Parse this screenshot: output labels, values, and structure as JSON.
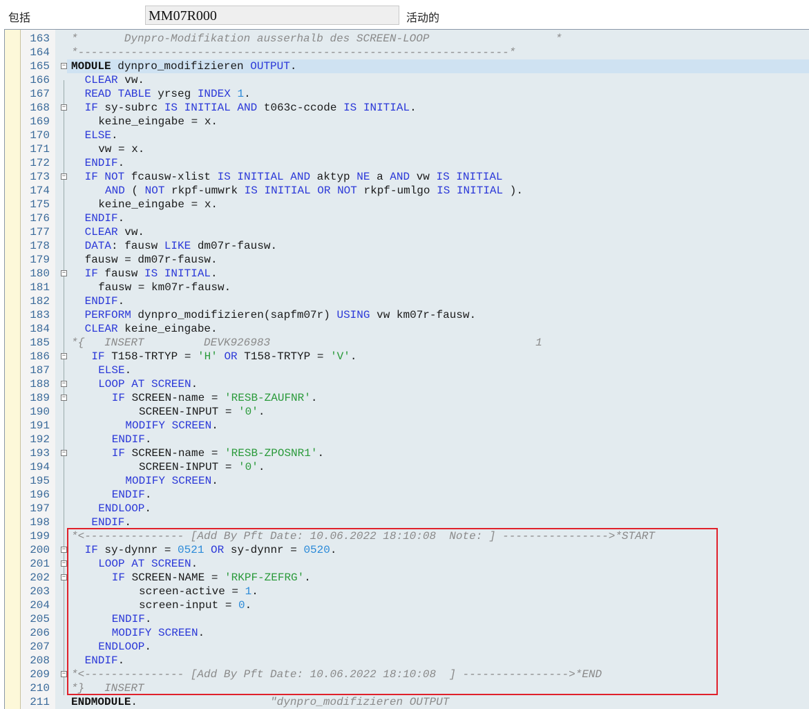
{
  "header": {
    "package_label": "包括",
    "program_name": "MM07R000",
    "status_text": "活动的"
  },
  "highlight": {
    "color": "#e0202a"
  },
  "lines": [
    {
      "n": "163",
      "indent": 0,
      "fold": false,
      "tokens": [
        [
          "cmt",
          "*       Dynpro-Modifikation ausserhalb des SCREEN-LOOP                   *"
        ]
      ]
    },
    {
      "n": "164",
      "indent": 0,
      "fold": false,
      "tokens": [
        [
          "cmt",
          "*-----------------------------------------------------------------*"
        ]
      ]
    },
    {
      "n": "165",
      "indent": 0,
      "fold": true,
      "tokens": [
        [
          "kwb",
          "MODULE"
        ],
        [
          "t",
          " dynpro_modifizieren "
        ],
        [
          "kw",
          "OUTPUT"
        ],
        [
          "t",
          "."
        ]
      ]
    },
    {
      "n": "166",
      "indent": 2,
      "fold": false,
      "tokens": [
        [
          "kw",
          "CLEAR"
        ],
        [
          "t",
          " vw."
        ]
      ]
    },
    {
      "n": "167",
      "indent": 2,
      "fold": false,
      "tokens": [
        [
          "kw",
          "READ TABLE"
        ],
        [
          "t",
          " yrseg "
        ],
        [
          "kw",
          "INDEX"
        ],
        [
          "t",
          " "
        ],
        [
          "num",
          "1"
        ],
        [
          "t",
          "."
        ]
      ]
    },
    {
      "n": "168",
      "indent": 2,
      "fold": true,
      "tokens": [
        [
          "kw",
          "IF"
        ],
        [
          "t",
          " sy-subrc "
        ],
        [
          "kw",
          "IS INITIAL AND"
        ],
        [
          "t",
          " t063c-ccode "
        ],
        [
          "kw",
          "IS INITIAL"
        ],
        [
          "t",
          "."
        ]
      ]
    },
    {
      "n": "169",
      "indent": 4,
      "fold": false,
      "tokens": [
        [
          "t",
          "keine_eingabe = x."
        ]
      ]
    },
    {
      "n": "170",
      "indent": 2,
      "fold": false,
      "tokens": [
        [
          "kw",
          "ELSE"
        ],
        [
          "t",
          "."
        ]
      ]
    },
    {
      "n": "171",
      "indent": 4,
      "fold": false,
      "tokens": [
        [
          "t",
          "vw = x."
        ]
      ]
    },
    {
      "n": "172",
      "indent": 2,
      "fold": false,
      "tokens": [
        [
          "kw",
          "ENDIF"
        ],
        [
          "t",
          "."
        ]
      ]
    },
    {
      "n": "173",
      "indent": 2,
      "fold": true,
      "tokens": [
        [
          "kw",
          "IF NOT"
        ],
        [
          "t",
          " fcausw-xlist "
        ],
        [
          "kw",
          "IS INITIAL AND"
        ],
        [
          "t",
          " aktyp "
        ],
        [
          "kw",
          "NE"
        ],
        [
          "t",
          " a "
        ],
        [
          "kw",
          "AND"
        ],
        [
          "t",
          " vw "
        ],
        [
          "kw",
          "IS INITIAL"
        ]
      ]
    },
    {
      "n": "174",
      "indent": 5,
      "fold": false,
      "tokens": [
        [
          "kw",
          "AND"
        ],
        [
          "t",
          " ( "
        ],
        [
          "kw",
          "NOT"
        ],
        [
          "t",
          " rkpf-umwrk "
        ],
        [
          "kw",
          "IS INITIAL OR NOT"
        ],
        [
          "t",
          " rkpf-umlgo "
        ],
        [
          "kw",
          "IS INITIAL"
        ],
        [
          "t",
          " )."
        ]
      ]
    },
    {
      "n": "175",
      "indent": 4,
      "fold": false,
      "tokens": [
        [
          "t",
          "keine_eingabe = x."
        ]
      ]
    },
    {
      "n": "176",
      "indent": 2,
      "fold": false,
      "tokens": [
        [
          "kw",
          "ENDIF"
        ],
        [
          "t",
          "."
        ]
      ]
    },
    {
      "n": "177",
      "indent": 2,
      "fold": false,
      "tokens": [
        [
          "kw",
          "CLEAR"
        ],
        [
          "t",
          " vw."
        ]
      ]
    },
    {
      "n": "178",
      "indent": 2,
      "fold": false,
      "tokens": [
        [
          "kw",
          "DATA"
        ],
        [
          "t",
          ": fausw "
        ],
        [
          "kw",
          "LIKE"
        ],
        [
          "t",
          " dm07r-fausw."
        ]
      ]
    },
    {
      "n": "179",
      "indent": 2,
      "fold": false,
      "tokens": [
        [
          "t",
          "fausw = dm07r-fausw."
        ]
      ]
    },
    {
      "n": "180",
      "indent": 2,
      "fold": true,
      "tokens": [
        [
          "kw",
          "IF"
        ],
        [
          "t",
          " fausw "
        ],
        [
          "kw",
          "IS INITIAL"
        ],
        [
          "t",
          "."
        ]
      ]
    },
    {
      "n": "181",
      "indent": 4,
      "fold": false,
      "tokens": [
        [
          "t",
          "fausw = km07r-fausw."
        ]
      ]
    },
    {
      "n": "182",
      "indent": 2,
      "fold": false,
      "tokens": [
        [
          "kw",
          "ENDIF"
        ],
        [
          "t",
          "."
        ]
      ]
    },
    {
      "n": "183",
      "indent": 2,
      "fold": false,
      "tokens": [
        [
          "kw",
          "PERFORM"
        ],
        [
          "t",
          " dynpro_modifizieren(sapfm07r) "
        ],
        [
          "kw",
          "USING"
        ],
        [
          "t",
          " vw km07r-fausw."
        ]
      ]
    },
    {
      "n": "184",
      "indent": 2,
      "fold": false,
      "tokens": [
        [
          "kw",
          "CLEAR"
        ],
        [
          "t",
          " keine_eingabe."
        ]
      ]
    },
    {
      "n": "185",
      "indent": 0,
      "fold": false,
      "tokens": [
        [
          "cmt",
          "*{   INSERT         DEVK926983                                        1"
        ]
      ]
    },
    {
      "n": "186",
      "indent": 3,
      "fold": true,
      "tokens": [
        [
          "kw",
          "IF"
        ],
        [
          "t",
          " T158-TRTYP = "
        ],
        [
          "str",
          "'H'"
        ],
        [
          "t",
          " "
        ],
        [
          "kw",
          "OR"
        ],
        [
          "t",
          " T158-TRTYP = "
        ],
        [
          "str",
          "'V'"
        ],
        [
          "t",
          "."
        ]
      ]
    },
    {
      "n": "187",
      "indent": 4,
      "fold": false,
      "tokens": [
        [
          "kw",
          "ELSE"
        ],
        [
          "t",
          "."
        ]
      ]
    },
    {
      "n": "188",
      "indent": 4,
      "fold": true,
      "tokens": [
        [
          "kw",
          "LOOP AT SCREEN"
        ],
        [
          "t",
          "."
        ]
      ]
    },
    {
      "n": "189",
      "indent": 6,
      "fold": true,
      "tokens": [
        [
          "kw",
          "IF"
        ],
        [
          "t",
          " SCREEN-name = "
        ],
        [
          "str",
          "'RESB-ZAUFNR'"
        ],
        [
          "t",
          "."
        ]
      ]
    },
    {
      "n": "190",
      "indent": 10,
      "fold": false,
      "tokens": [
        [
          "t",
          "SCREEN-INPUT = "
        ],
        [
          "str",
          "'0'"
        ],
        [
          "t",
          "."
        ]
      ]
    },
    {
      "n": "191",
      "indent": 8,
      "fold": false,
      "tokens": [
        [
          "kw",
          "MODIFY SCREEN"
        ],
        [
          "t",
          "."
        ]
      ]
    },
    {
      "n": "192",
      "indent": 6,
      "fold": false,
      "tokens": [
        [
          "kw",
          "ENDIF"
        ],
        [
          "t",
          "."
        ]
      ]
    },
    {
      "n": "193",
      "indent": 6,
      "fold": true,
      "tokens": [
        [
          "kw",
          "IF"
        ],
        [
          "t",
          " SCREEN-name = "
        ],
        [
          "str",
          "'RESB-ZPOSNR1'"
        ],
        [
          "t",
          "."
        ]
      ]
    },
    {
      "n": "194",
      "indent": 10,
      "fold": false,
      "tokens": [
        [
          "t",
          "SCREEN-INPUT = "
        ],
        [
          "str",
          "'0'"
        ],
        [
          "t",
          "."
        ]
      ]
    },
    {
      "n": "195",
      "indent": 8,
      "fold": false,
      "tokens": [
        [
          "kw",
          "MODIFY SCREEN"
        ],
        [
          "t",
          "."
        ]
      ]
    },
    {
      "n": "196",
      "indent": 6,
      "fold": false,
      "tokens": [
        [
          "kw",
          "ENDIF"
        ],
        [
          "t",
          "."
        ]
      ]
    },
    {
      "n": "197",
      "indent": 4,
      "fold": false,
      "tokens": [
        [
          "kw",
          "ENDLOOP"
        ],
        [
          "t",
          "."
        ]
      ]
    },
    {
      "n": "198",
      "indent": 3,
      "fold": false,
      "tokens": [
        [
          "kw",
          "ENDIF"
        ],
        [
          "t",
          "."
        ]
      ]
    },
    {
      "n": "199",
      "indent": 0,
      "fold": false,
      "tokens": [
        [
          "cmt",
          "*<--------------- [Add By Pft Date: 10.06.2022 18:10:08  Note: ] ---------------->*START"
        ]
      ]
    },
    {
      "n": "200",
      "indent": 2,
      "fold": true,
      "tokens": [
        [
          "kw",
          "IF"
        ],
        [
          "t",
          " sy-dynnr = "
        ],
        [
          "num",
          "0521"
        ],
        [
          "t",
          " "
        ],
        [
          "kw",
          "OR"
        ],
        [
          "t",
          " sy-dynnr = "
        ],
        [
          "num",
          "0520"
        ],
        [
          "t",
          "."
        ]
      ]
    },
    {
      "n": "201",
      "indent": 4,
      "fold": true,
      "tokens": [
        [
          "kw",
          "LOOP AT SCREEN"
        ],
        [
          "t",
          "."
        ]
      ]
    },
    {
      "n": "202",
      "indent": 6,
      "fold": true,
      "tokens": [
        [
          "kw",
          "IF"
        ],
        [
          "t",
          " SCREEN-NAME = "
        ],
        [
          "str",
          "'RKPF-ZEFRG'"
        ],
        [
          "t",
          "."
        ]
      ]
    },
    {
      "n": "203",
      "indent": 10,
      "fold": false,
      "tokens": [
        [
          "t",
          "screen-active = "
        ],
        [
          "num",
          "1"
        ],
        [
          "t",
          "."
        ]
      ]
    },
    {
      "n": "204",
      "indent": 10,
      "fold": false,
      "tokens": [
        [
          "t",
          "screen-input = "
        ],
        [
          "num",
          "0"
        ],
        [
          "t",
          "."
        ]
      ]
    },
    {
      "n": "205",
      "indent": 6,
      "fold": false,
      "tokens": [
        [
          "kw",
          "ENDIF"
        ],
        [
          "t",
          "."
        ]
      ]
    },
    {
      "n": "206",
      "indent": 6,
      "fold": false,
      "tokens": [
        [
          "kw",
          "MODIFY SCREEN"
        ],
        [
          "t",
          "."
        ]
      ]
    },
    {
      "n": "207",
      "indent": 4,
      "fold": false,
      "tokens": [
        [
          "kw",
          "ENDLOOP"
        ],
        [
          "t",
          "."
        ]
      ]
    },
    {
      "n": "208",
      "indent": 2,
      "fold": false,
      "tokens": [
        [
          "kw",
          "ENDIF"
        ],
        [
          "t",
          "."
        ]
      ]
    },
    {
      "n": "209",
      "indent": 0,
      "fold": true,
      "tokens": [
        [
          "cmt",
          "*<--------------- [Add By Pft Date: 10.06.2022 18:10:08  ] ---------------->*END"
        ]
      ]
    },
    {
      "n": "210",
      "indent": 0,
      "fold": false,
      "tokens": [
        [
          "cmt",
          "*}   INSERT"
        ]
      ]
    },
    {
      "n": "211",
      "indent": 0,
      "fold": false,
      "tokens": [
        [
          "kwb",
          "ENDMODULE"
        ],
        [
          "t",
          ".                    "
        ],
        [
          "cmt",
          "\"dynpro_modifizieren OUTPUT"
        ]
      ]
    }
  ]
}
